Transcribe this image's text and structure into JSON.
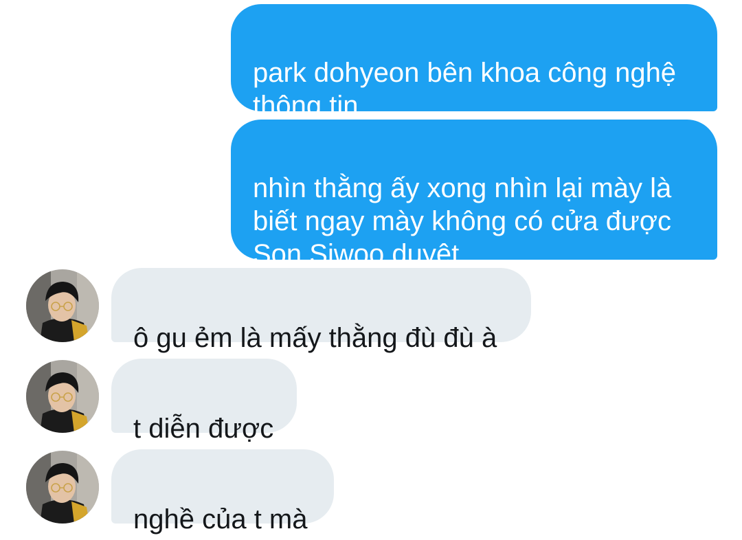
{
  "conversation": {
    "messages": [
      {
        "sender": "me",
        "text": "park dohyeon bên khoa công nghệ\nthông tin"
      },
      {
        "sender": "me",
        "text": "nhìn thằng ấy xong nhìn lại mày là\nbiết ngay mày không có cửa được\nSon Siwoo duyệt"
      },
      {
        "sender": "other",
        "text": "ô gu ẻm là mấy thằng đù đù à"
      },
      {
        "sender": "other",
        "text": "t diễn được"
      },
      {
        "sender": "other",
        "text": "nghề của t mà"
      }
    ]
  },
  "colors": {
    "outgoing_bubble": "#1da1f2",
    "incoming_bubble": "#e6ecf0",
    "incoming_text": "#14171a"
  },
  "icons": {
    "avatar": "avatar-photo"
  }
}
